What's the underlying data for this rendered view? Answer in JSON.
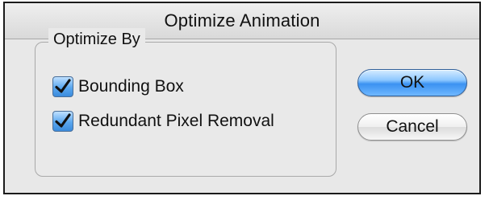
{
  "dialog": {
    "title": "Optimize Animation",
    "group": {
      "label": "Optimize By",
      "options": [
        {
          "label": "Bounding Box",
          "checked": true
        },
        {
          "label": "Redundant Pixel Removal",
          "checked": true
        }
      ]
    },
    "buttons": {
      "ok_label": "OK",
      "cancel_label": "Cancel"
    }
  }
}
